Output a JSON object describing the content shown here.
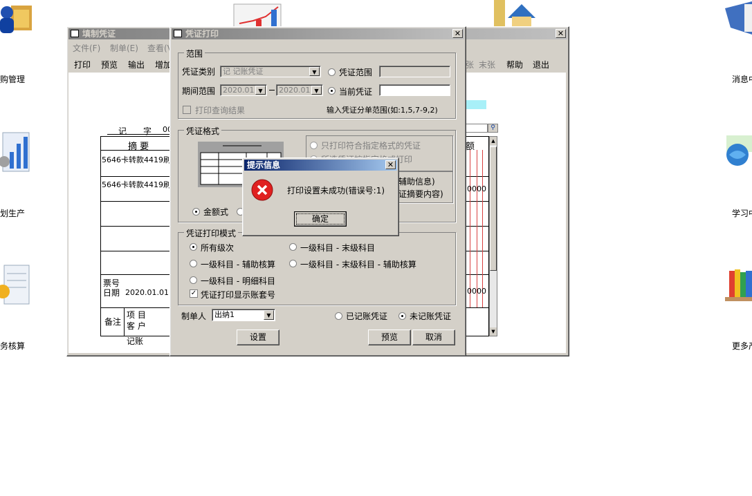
{
  "desktop": {
    "icons_left": [
      {
        "label": "购管理",
        "icon": "user-folder-icon"
      },
      {
        "label": "划生产",
        "icon": "bar-chart-icon"
      },
      {
        "label": "务核算",
        "icon": "finance-icon"
      }
    ],
    "icons_right": [
      {
        "label": "消息中",
        "icon": "message-icon"
      },
      {
        "label": "学习中",
        "icon": "globe-icon"
      },
      {
        "label": "更多产",
        "icon": "books-icon"
      }
    ]
  },
  "voucher_window": {
    "title": "填制凭证",
    "menu": [
      "文件(F)",
      "制单(E)",
      "查看(V)"
    ],
    "toolbar_left": [
      "打印",
      "预览",
      "输出",
      "增加"
    ],
    "toolbar_right": [
      "末张",
      "帮助",
      "退出"
    ],
    "toolbar_right_prefix": "张",
    "header_prefix": "记",
    "header_zi": "字",
    "header_no": "00",
    "col_summary": "摘  要",
    "col_amount": "额",
    "rows": [
      "5646卡转款4419刷卡",
      "5646卡转款4419刷卡",
      "",
      "",
      ""
    ],
    "amounts": [
      "0000",
      "",
      "",
      "0000"
    ],
    "ticket_label": "票号",
    "date_label": "日期",
    "date_value": "2020.01.01",
    "remark_label": "备注",
    "project_label": "项  目",
    "customer_label": "客  户",
    "bookkeep_label": "记账"
  },
  "print_dialog": {
    "title": "凭证打印",
    "range_group": "范围",
    "voucher_type_label": "凭证类别",
    "voucher_type_value": "记 记账凭证",
    "voucher_range_label": "凭证范围",
    "period_label": "期间范围",
    "period_from": "2020.01",
    "period_to": "2020.01",
    "current_voucher_label": "当前凭证",
    "print_query_label": "打印查询结果",
    "split_range_hint": "输入凭证分单范围(如:1,5,7-9,2)",
    "format_group": "凭证格式",
    "only_print_format": "只打印符合指定格式的凭证",
    "format_option2": "所选凭证按指定格式打印",
    "aux_info": "辅助信息)",
    "summary_content": "证摘要内容)",
    "amount_style": "金额式",
    "mode_group": "凭证打印模式",
    "mode_all": "所有级次",
    "mode_first_last": "一级科目 - 末级科目",
    "mode_first_aux": "一级科目 - 辅助核算",
    "mode_first_last_aux": "一级科目 - 末级科目 - 辅助核算",
    "mode_first_detail": "一级科目 - 明细科目",
    "show_account_set": "凭证打印显示账套号",
    "maker_label": "制单人",
    "maker_value": "出纳1",
    "posted_label": "已记账凭证",
    "unposted_label": "未记账凭证",
    "setup_button": "设置",
    "preview_button": "预览",
    "cancel_button": "取消"
  },
  "message_box": {
    "title": "提示信息",
    "message": "打印设置未成功(错误号:1)",
    "ok_button": "确定"
  }
}
